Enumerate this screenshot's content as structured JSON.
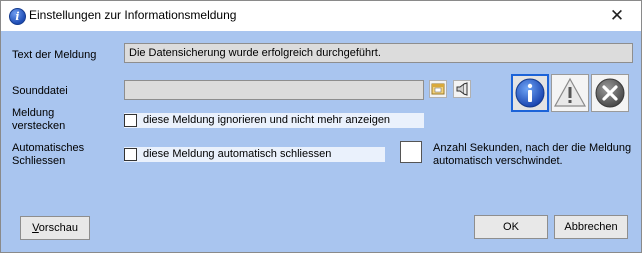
{
  "window": {
    "title": "Einstellungen zur Informationsmeldung",
    "close_glyph": "✕"
  },
  "form": {
    "message_label": "Text der Meldung",
    "message_value": "Die Datensicherung wurde erfolgreich durchgeführt.",
    "sound_label": "Sounddatei",
    "sound_value": "",
    "hide_label_1": "Meldung",
    "hide_label_2": "verstecken",
    "hide_checkbox_label": "diese Meldung ignorieren und nicht mehr anzeigen",
    "hide_checked": false,
    "auto_label_1": "Automatisches",
    "auto_label_2": "Schliessen",
    "auto_checkbox_label": "diese Meldung automatisch schliessen",
    "auto_checked": false,
    "seconds_value": "",
    "seconds_hint_1": "Anzahl Sekunden, nach der die Meldung",
    "seconds_hint_2": "automatisch verschwindet."
  },
  "icons": {
    "selected": "info",
    "options": [
      "info-icon",
      "warning-icon",
      "error-icon"
    ]
  },
  "buttons": {
    "preview_first": "V",
    "preview_rest": "orschau",
    "ok": "OK",
    "cancel": "Abbrechen"
  }
}
